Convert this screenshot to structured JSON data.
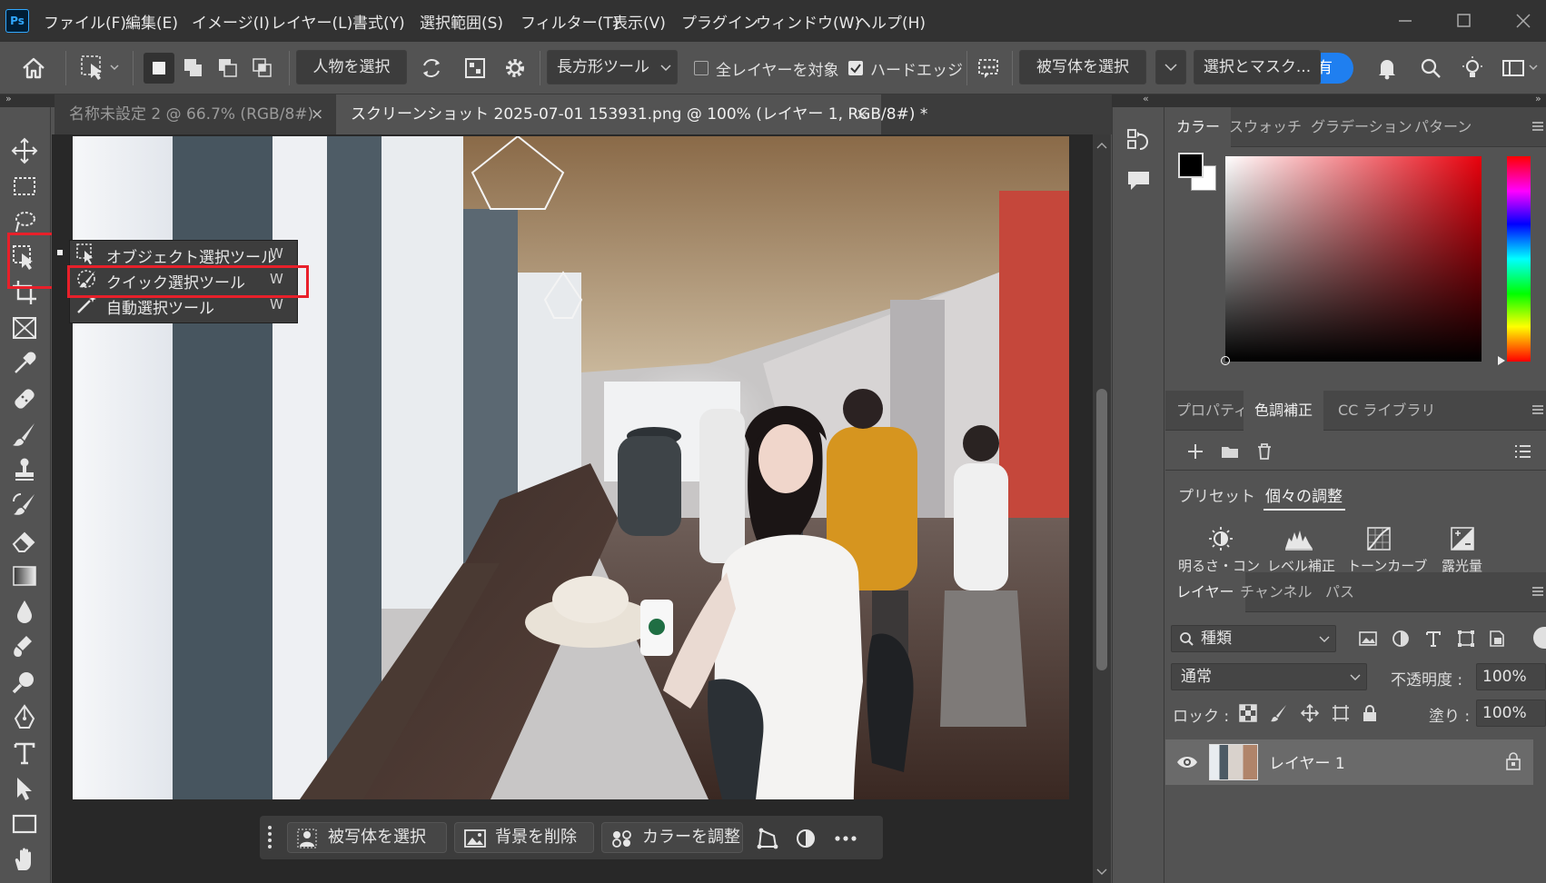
{
  "app": {
    "logo_text": "Ps"
  },
  "menu": [
    "ファイル(F)",
    "編集(E)",
    "イメージ(I)",
    "レイヤー(L)",
    "書式(Y)",
    "選択範囲(S)",
    "フィルター(T)",
    "表示(V)",
    "プラグイン",
    "ウィンドウ(W)",
    "ヘルプ(H)"
  ],
  "options": {
    "select_person": "人物を選択",
    "mode": "長方形ツール",
    "all_layers": "全レイヤーを対象",
    "hard_edge": "ハードエッジ",
    "select_subject": "被写体を選択",
    "select_mask": "選択とマスク...",
    "blue_btn": "有"
  },
  "tabs": [
    {
      "label": "名称未設定 2 @ 66.7% (RGB/8#)",
      "close": "×"
    },
    {
      "label": "スクリーンショット 2025-07-01 153931.png @ 100% (レイヤー 1, RGB/8#) *",
      "close": "×"
    }
  ],
  "flyout": [
    {
      "label": "オブジェクト選択ツール",
      "key": "W"
    },
    {
      "label": "クイック選択ツール",
      "key": "W"
    },
    {
      "label": "自動選択ツール",
      "key": "W"
    }
  ],
  "taskbar": {
    "subject": "被写体を選択",
    "remove_bg": "背景を削除",
    "adjust_color": "カラーを調整"
  },
  "color_panel": {
    "tabs": [
      "カラー",
      "スウォッチ",
      "グラデーション",
      "パターン"
    ]
  },
  "adjust_panel": {
    "tabs": [
      "プロパティ",
      "色調補正",
      "CC ライブラリ"
    ],
    "subtabs": [
      "プリセット",
      "個々の調整"
    ],
    "items": [
      "明るさ・コン",
      "レベル補正",
      "トーンカーブ",
      "露光量"
    ]
  },
  "layers_panel": {
    "tabs": [
      "レイヤー",
      "チャンネル",
      "パス"
    ],
    "filter": "種類",
    "blend": "通常",
    "opacity_label": "不透明度 :",
    "opacity": "100%",
    "lock_label": "ロック :",
    "fill_label": "塗り :",
    "fill": "100%",
    "layer_name": "レイヤー 1"
  },
  "colors": {
    "accent_red": "#e8202a",
    "blue": "#1f7ff0",
    "foreground": "#000000",
    "background": "#ffffff"
  }
}
